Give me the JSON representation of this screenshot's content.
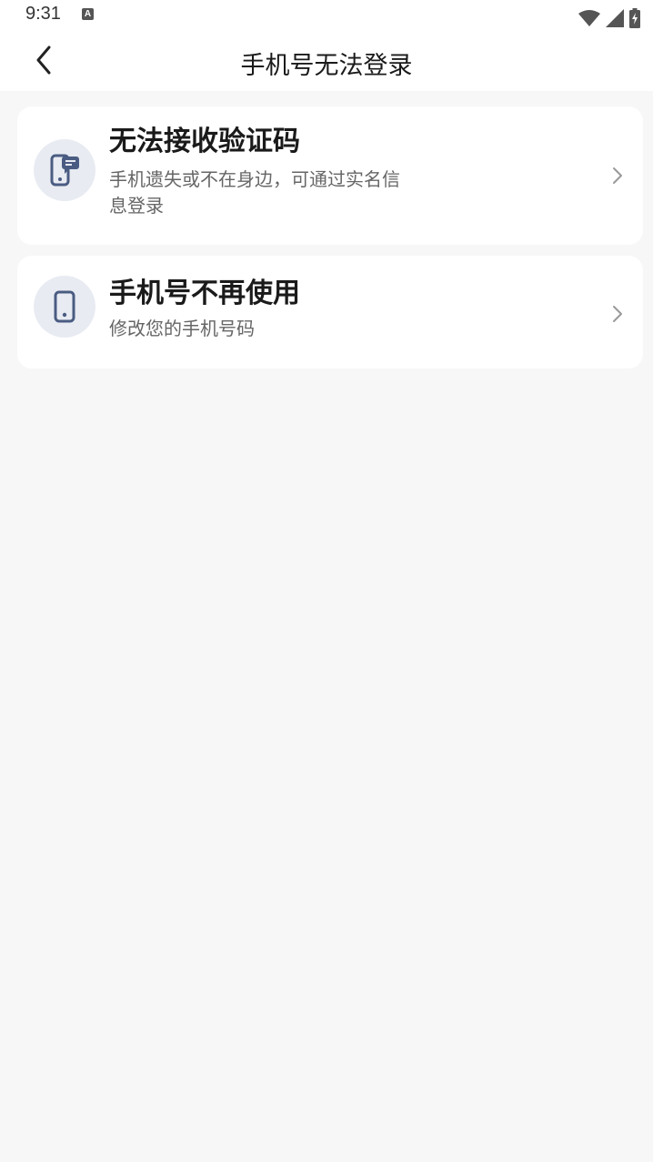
{
  "status_bar": {
    "time": "9:31",
    "notification_badge": "A",
    "icons": [
      "wifi-icon",
      "signal-icon",
      "battery-charging-icon"
    ]
  },
  "header": {
    "title": "手机号无法登录",
    "back_icon": "chevron-left-icon"
  },
  "options": [
    {
      "title": "无法接收验证码",
      "description": "手机遗失或不在身边，可通过实名信息登录",
      "icon": "phone-message-icon",
      "arrow_icon": "chevron-right-icon"
    },
    {
      "title": "手机号不再使用",
      "description": "修改您的手机号码",
      "icon": "phone-icon",
      "arrow_icon": "chevron-right-icon"
    }
  ],
  "colors": {
    "page_background": "#f7f7f7",
    "card_background": "#ffffff",
    "icon_circle": "#e8ebf2",
    "icon_color": "#4a5c82"
  }
}
